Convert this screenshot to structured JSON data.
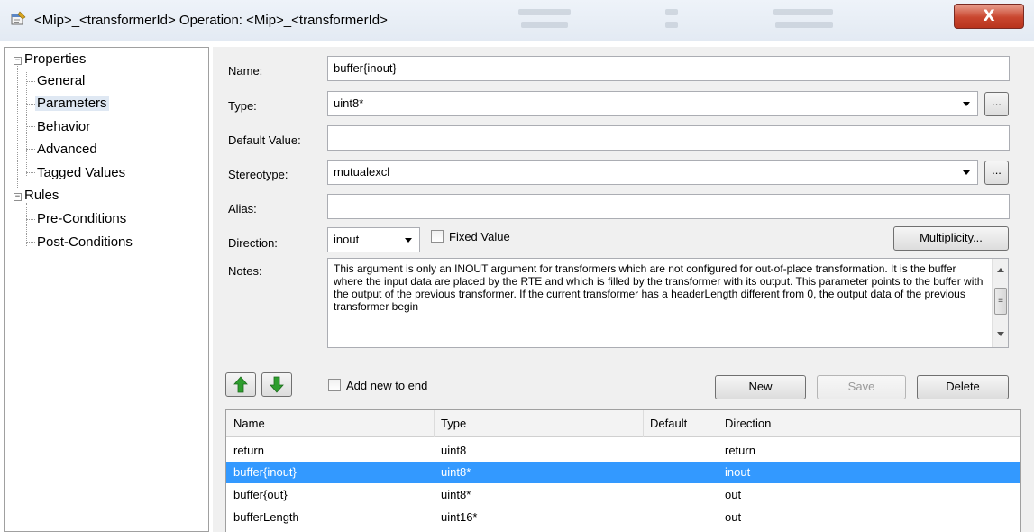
{
  "window": {
    "title": "<Mip>_<transformerId> Operation: <Mip>_<transformerId>",
    "close_label": "X"
  },
  "tree": {
    "properties": "Properties",
    "properties_children": [
      "General",
      "Parameters",
      "Behavior",
      "Advanced",
      "Tagged Values"
    ],
    "rules": "Rules",
    "rules_children": [
      "Pre-Conditions",
      "Post-Conditions"
    ],
    "selected": "Parameters"
  },
  "form": {
    "name_label": "Name:",
    "name_value": "buffer{inout}",
    "type_label": "Type:",
    "type_value": "uint8*",
    "default_label": "Default Value:",
    "default_value": "",
    "stereotype_label": "Stereotype:",
    "stereotype_value": "mutualexcl",
    "alias_label": "Alias:",
    "alias_value": "",
    "direction_label": "Direction:",
    "direction_value": "inout",
    "fixed_value_label": "Fixed Value",
    "multiplicity_label": "Multiplicity...",
    "notes_label": "Notes:",
    "notes_text": "This argument is only an INOUT argument for transformers which are not configured for out-of-place transformation. It is the buffer where the input data are placed by the RTE and which is filled by the transformer with its output. This parameter points to the buffer with the output of the previous transformer. If the current transformer has a headerLength different from 0, the output data of the previous transformer begin",
    "ellipsis": "..."
  },
  "toolbar": {
    "add_new_label": "Add new to end",
    "new_label": "New",
    "save_label": "Save",
    "delete_label": "Delete"
  },
  "grid": {
    "headers": [
      "Name",
      "Type",
      "Default",
      "Direction"
    ],
    "rows": [
      {
        "name": "return",
        "type": "uint8",
        "default": "",
        "direction": "return"
      },
      {
        "name": "buffer{inout}",
        "type": "uint8*",
        "default": "",
        "direction": "inout"
      },
      {
        "name": "buffer{out}",
        "type": "uint8*",
        "default": "",
        "direction": "out"
      },
      {
        "name": "bufferLength",
        "type": "uint16*",
        "default": "",
        "direction": "out"
      }
    ],
    "selected_index": 1
  },
  "colors": {
    "selection": "#3399ff",
    "close_button": "#c9462f",
    "arrow_green": "#2e9e2e",
    "panel_bg": "#f0f0f0"
  }
}
